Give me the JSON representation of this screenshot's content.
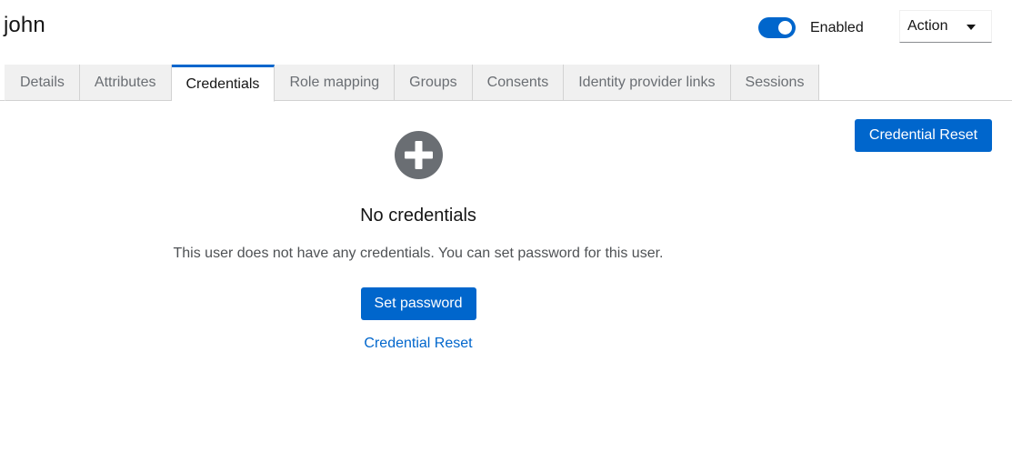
{
  "header": {
    "title": "john",
    "enabled_toggle": {
      "label": "Enabled",
      "on": true
    },
    "action_dropdown": {
      "label": "Action",
      "icon": "caret-down-icon"
    }
  },
  "tabs": [
    {
      "label": "Details",
      "active": false
    },
    {
      "label": "Attributes",
      "active": false
    },
    {
      "label": "Credentials",
      "active": true
    },
    {
      "label": "Role mapping",
      "active": false
    },
    {
      "label": "Groups",
      "active": false
    },
    {
      "label": "Consents",
      "active": false
    },
    {
      "label": "Identity provider links",
      "active": false
    },
    {
      "label": "Sessions",
      "active": false
    }
  ],
  "toolbar": {
    "credential_reset_label": "Credential Reset"
  },
  "empty_state": {
    "icon": "plus-circle-icon",
    "title": "No credentials",
    "body": "This user does not have any credentials. You can set password for this user.",
    "primary_action": "Set password",
    "secondary_link": "Credential Reset"
  },
  "colors": {
    "accent": "#0066cc",
    "icon_gray": "#6a6e73",
    "tab_bg": "#f0f0f0"
  }
}
